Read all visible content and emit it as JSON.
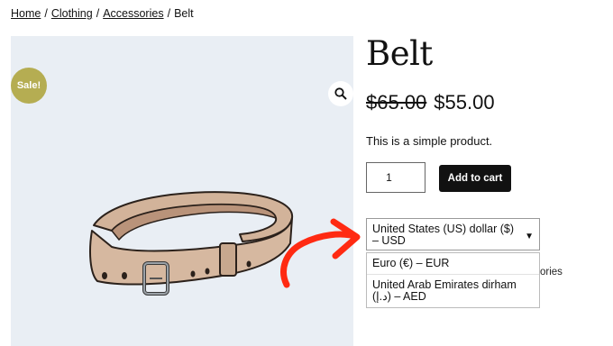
{
  "breadcrumb": {
    "items": [
      "Home",
      "Clothing",
      "Accessories"
    ],
    "current": "Belt",
    "separator": "/"
  },
  "product": {
    "sale_badge": "Sale!",
    "title": "Belt",
    "old_price": "$65.00",
    "new_price": "$55.00",
    "description": "This is a simple product.",
    "quantity": "1",
    "add_to_cart_label": "Add to cart"
  },
  "currency": {
    "selected": "United States (US) dollar ($) – USD",
    "options": [
      "Euro (€) – EUR",
      "United Arab Emirates dirham (د.إ) – AED"
    ],
    "behind_text": "ories"
  },
  "icons": {
    "zoom": "magnifier-icon",
    "select_arrow": "caret-down-icon",
    "annotation": "red-arrow-icon"
  },
  "colors": {
    "sale_badge": "#b5ad52",
    "gallery_bg": "#e9eef4",
    "annotation_arrow": "#ff2a12",
    "button_bg": "#111111"
  }
}
